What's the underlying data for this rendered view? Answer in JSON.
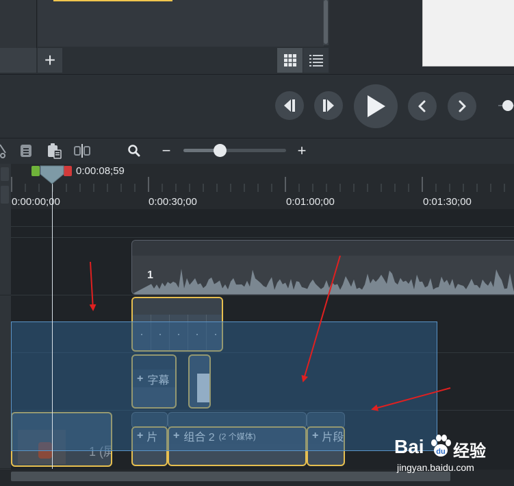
{
  "media": {
    "add_label": "+"
  },
  "toolbar": {
    "zoom_out_label": "−",
    "zoom_in_label": "+",
    "zoom_level": 0.36
  },
  "playhead": {
    "time": "0:00:08;59"
  },
  "ruler": {
    "labels": [
      "0:00:00;00",
      "0:00:30;00",
      "0:01:00;00",
      "0:01:30;00"
    ]
  },
  "tracks": {
    "audio_clip_number": "1",
    "caption_clip_label": "字幕",
    "group_clip_label": "组合 2",
    "group_clip_count": "(2 个媒体)",
    "segment_label_short": "片",
    "segment_label_long": "片段",
    "video_clip_label": "1 (屏"
  },
  "watermark": {
    "brand": "Bai",
    "brand_suffix": "经验",
    "url": "jingyan.baidu.com"
  },
  "colors": {
    "selected_clip_border": "#e7bf4f",
    "selection_fill": "#2e689c",
    "annotation_arrow": "#e02020",
    "playhead_green": "#6fb33a",
    "playhead_red": "#d23a3a"
  }
}
